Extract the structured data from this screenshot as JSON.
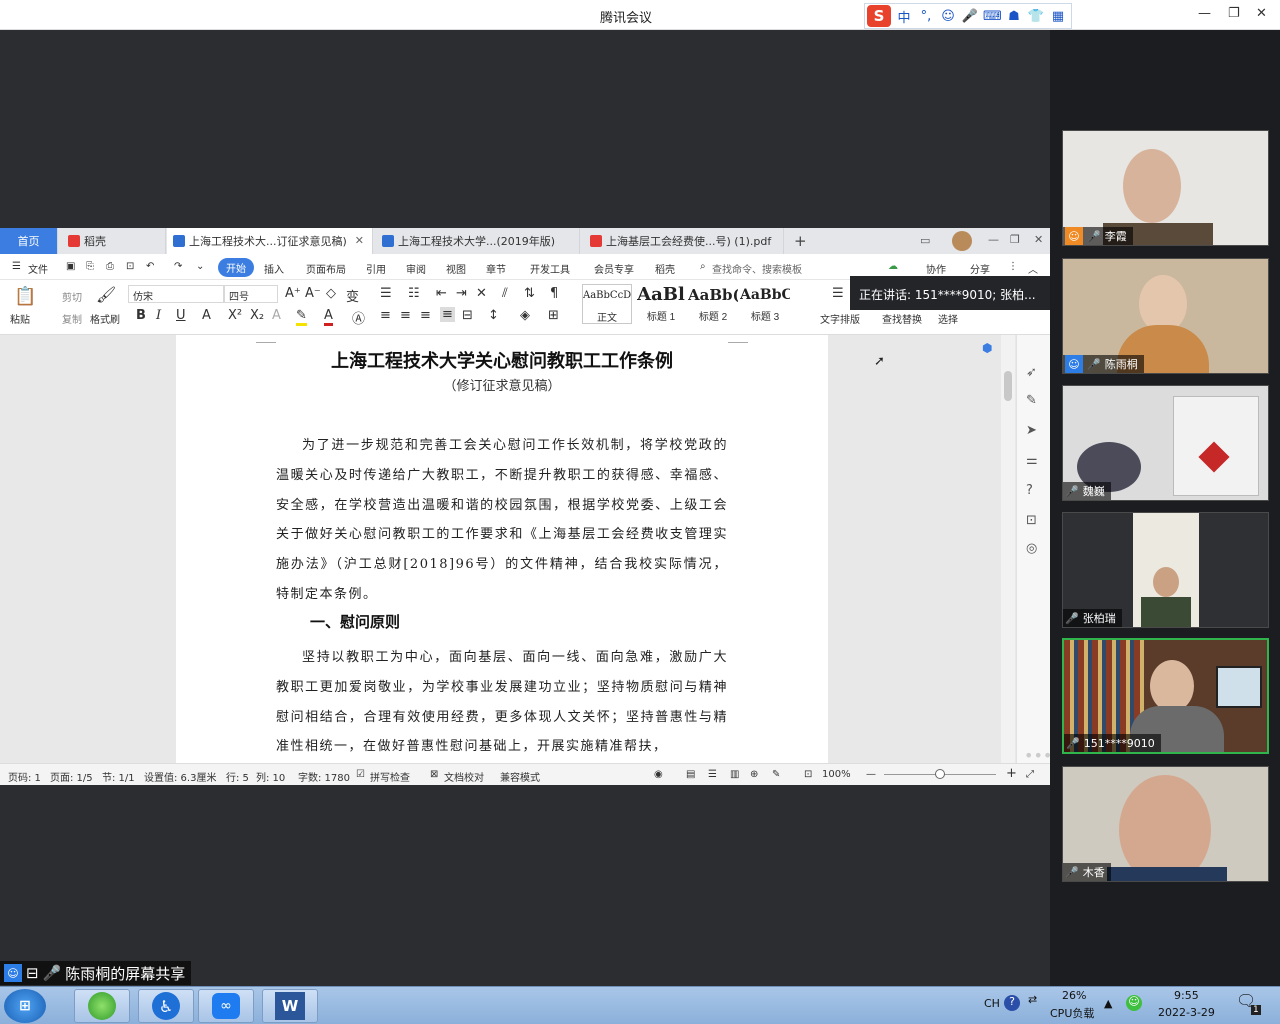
{
  "app_title": "腾讯会议",
  "ime": {
    "mode": "中"
  },
  "wps": {
    "tabs": [
      {
        "label": "首页"
      },
      {
        "label": "稻壳"
      },
      {
        "label": "上海工程技术大...订征求意见稿)"
      },
      {
        "label": "上海工程技术大学...(2019年版)"
      },
      {
        "label": "上海基层工会经费使...号) (1).pdf"
      }
    ],
    "new_tab": "+",
    "menu": {
      "file": "文件",
      "start": "开始",
      "items": [
        "插入",
        "页面布局",
        "引用",
        "审阅",
        "视图",
        "章节",
        "开发工具",
        "会员专享",
        "稻壳"
      ],
      "search": "查找命令、搜索模板",
      "collab": "协作",
      "share": "分享"
    },
    "ribbon": {
      "paste": "粘贴",
      "cut": "剪切",
      "copy": "复制",
      "format_painter": "格式刷",
      "font_name": "仿宋",
      "font_size": "四号",
      "styles": [
        {
          "preview": "AaBbCcDd",
          "label": "正文"
        },
        {
          "preview": "AaBl",
          "label": "标题 1"
        },
        {
          "preview": "AaBb(",
          "label": "标题 2"
        },
        {
          "preview": "AaBbC",
          "label": "标题 3"
        }
      ],
      "text_layout": "文字排版",
      "find_replace": "查找替换",
      "select": "选择"
    },
    "doc": {
      "title": "上海工程技术大学关心慰问教职工工作条例",
      "subtitle": "（修订征求意见稿）",
      "para1": "为了进一步规范和完善工会关心慰问工作长效机制，将学校党政的温暖关心及时传递给广大教职工，不断提升教职工的获得感、幸福感、安全感，在学校营造出温暖和谐的校园氛围，根据学校党委、上级工会关于做好关心慰问教职工的工作要求和《上海基层工会经费收支管理实施办法》（沪工总财[2018]96号）的文件精神，结合我校实际情况，特制定本条例。",
      "heading1": "一、慰问原则",
      "para2": "坚持以教职工为中心，面向基层、面向一线、面向急难，激励广大教职工更加爱岗敬业，为学校事业发展建功立业；坚持物质慰问与精神慰问相结合，合理有效使用经费，更多体现人文关怀；坚持普惠性与精准性相统一，在做好普惠性慰问基础上，开展实施精准帮扶，"
    },
    "status": {
      "page_code": "页码: 1",
      "pages": "页面: 1/5",
      "section": "节: 1/1",
      "setting": "设置值: 6.3厘米",
      "row": "行: 5",
      "col": "列: 10",
      "words": "字数: 1780",
      "spell": "拼写检查",
      "proof": "文档校对",
      "compat": "兼容模式",
      "zoom": "100%",
      "zoom_fraction": 0.5
    }
  },
  "speaking_tooltip": "正在讲话: 151****9010; 张柏...",
  "participants": [
    {
      "name": "李霞",
      "host": true
    },
    {
      "name": "陈雨桐",
      "host": true
    },
    {
      "name": "魏巍",
      "host": false
    },
    {
      "name": "张柏瑞",
      "host": false
    },
    {
      "name": "151****9010",
      "host": false,
      "speaking": true
    },
    {
      "name": "木香",
      "host": false
    }
  ],
  "screen_share_label": "陈雨桐的屏幕共享",
  "taskbar": {
    "lang": "CH",
    "cpu_percent": "26%",
    "cpu_label": "CPU负载",
    "time": "9:55",
    "date": "2022-3-29",
    "notify_count": "1"
  },
  "colors": {
    "accent": "#3b7de0",
    "speaking_border": "#2fb54c",
    "brand_red": "#e8422c"
  }
}
